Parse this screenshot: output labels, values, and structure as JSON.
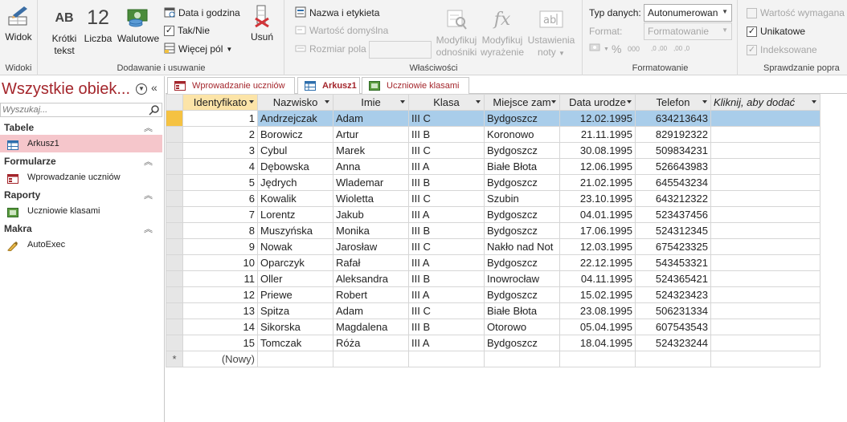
{
  "ribbon": {
    "widok": {
      "label": "Widok",
      "group": "Widoki"
    },
    "group_add": {
      "label": "Dodawanie i usuwanie",
      "krotki_tekst": "Krótki\ntekst",
      "krotki_tekst_l1": "Krótki",
      "krotki_tekst_l2": "tekst",
      "krotki_icon_text": "AB",
      "liczba": "Liczba",
      "liczba_icon_text": "12",
      "walutowe": "Walutowe",
      "data_i_godzina": "Data i godzina",
      "tak_nie": "Tak/Nie",
      "wiecej_pol": "Więcej pól",
      "usun": "Usuń"
    },
    "group_props": {
      "label": "Właściwości",
      "nazwa_i_etykieta": "Nazwa i etykieta",
      "wartosc_domyslna": "Wartość domyślna",
      "rozmiar_pola": "Rozmiar pola",
      "modyfikuj_odnosniki_l1": "Modyfikuj",
      "modyfikuj_odnosniki_l2": "odnośniki",
      "modyfikuj_wyrazenie_l1": "Modyfikuj",
      "modyfikuj_wyrazenie_l2": "wyrażenie",
      "ustawienia_noty_l1": "Ustawienia",
      "ustawienia_noty_l2": "noty"
    },
    "group_format": {
      "label": "Formatowanie",
      "typ_danych_label": "Typ danych:",
      "typ_danych_value": "Autonumerowan",
      "format_label": "Format:",
      "format_value": "Formatowanie",
      "percent": "%",
      "thousands": "000",
      "dec_inc": ",0 ,00",
      "dec_dec": ",00 ,0"
    },
    "group_validation": {
      "label": "Sprawdzanie popra",
      "wartosc_wymagana": "Wartość wymagana",
      "unikatowe": "Unikatowe",
      "indeksowane": "Indeksowane"
    }
  },
  "nav": {
    "title": "Wszystkie obiek...",
    "search_placeholder": "Wyszukaj...",
    "categories": [
      {
        "name": "Tabele",
        "items": [
          "Arkusz1"
        ]
      },
      {
        "name": "Formularze",
        "items": [
          "Wprowadzanie uczniów"
        ]
      },
      {
        "name": "Raporty",
        "items": [
          "Uczniowie klasami"
        ]
      },
      {
        "name": "Makra",
        "items": [
          "AutoExec"
        ]
      }
    ]
  },
  "tabs": [
    {
      "label": "Wprowadzanie uczniów",
      "active": false
    },
    {
      "label": "Arkusz1",
      "active": true
    },
    {
      "label": "Uczniowie klasami",
      "active": false
    }
  ],
  "table": {
    "columns": [
      "Identyfikato",
      "Nazwisko",
      "Imie",
      "Klasa",
      "Miejsce zam",
      "Data urodze",
      "Telefon",
      "Kliknij, aby dodać"
    ],
    "rows": [
      [
        "1",
        "Andrzejczak",
        "Adam",
        "III C",
        "Bydgoszcz",
        "12.02.1995",
        "634213643"
      ],
      [
        "2",
        "Borowicz",
        "Artur",
        "III B",
        "Koronowo",
        "21.11.1995",
        "829192322"
      ],
      [
        "3",
        "Cybul",
        "Marek",
        "III C",
        "Bydgoszcz",
        "30.08.1995",
        "509834231"
      ],
      [
        "4",
        "Dębowska",
        "Anna",
        "III A",
        "Białe Błota",
        "12.06.1995",
        "526643983"
      ],
      [
        "5",
        "Jędrych",
        "Wlademar",
        "III B",
        "Bydgoszcz",
        "21.02.1995",
        "645543234"
      ],
      [
        "6",
        "Kowalik",
        "Wioletta",
        "III C",
        "Szubin",
        "23.10.1995",
        "643212322"
      ],
      [
        "7",
        "Lorentz",
        "Jakub",
        "III A",
        "Bydgoszcz",
        "04.01.1995",
        "523437456"
      ],
      [
        "8",
        "Muszyńska",
        "Monika",
        "III B",
        "Bydgoszcz",
        "17.06.1995",
        "524312345"
      ],
      [
        "9",
        "Nowak",
        "Jarosław",
        "III C",
        "Nakło nad Not",
        "12.03.1995",
        "675423325"
      ],
      [
        "10",
        "Oparczyk",
        "Rafał",
        "III A",
        "Bydgoszcz",
        "22.12.1995",
        "543453321"
      ],
      [
        "11",
        "Oller",
        "Aleksandra",
        "III B",
        "Inowrocław",
        "04.11.1995",
        "524365421"
      ],
      [
        "12",
        "Priewe",
        "Robert",
        "III A",
        "Bydgoszcz",
        "15.02.1995",
        "524323423"
      ],
      [
        "13",
        "Spitza",
        "Adam",
        "III C",
        "Białe Błota",
        "23.08.1995",
        "506231334"
      ],
      [
        "14",
        "Sikorska",
        "Magdalena",
        "III B",
        "Otorowo",
        "05.04.1995",
        "607543543"
      ],
      [
        "15",
        "Tomczak",
        "Róża",
        "III A",
        "Bydgoszcz",
        "18.04.1995",
        "524323244"
      ]
    ],
    "new_row_label": "(Nowy)",
    "new_row_marker": "*"
  },
  "colors": {
    "accent": "#a4262c",
    "selected_row": "#a9cdea",
    "row_selector": "#f5c242",
    "nav_selected": "#f5c6cb"
  }
}
